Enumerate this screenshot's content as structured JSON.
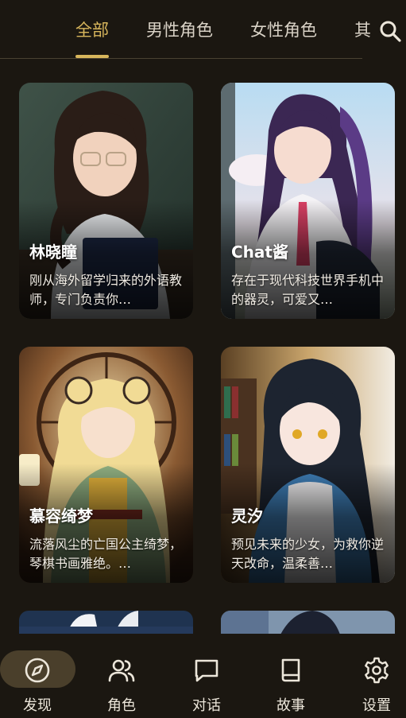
{
  "tabs": [
    {
      "label": "全部",
      "active": true
    },
    {
      "label": "男性角色",
      "active": false
    },
    {
      "label": "女性角色",
      "active": false
    },
    {
      "label": "其",
      "active": false
    }
  ],
  "accent_color": "#d8b65c",
  "search": {
    "icon": "search-icon"
  },
  "cards": [
    {
      "name": "林晓瞳",
      "description": "刚从海外留学归来的外语教师，专门负责你…"
    },
    {
      "name": "Chat酱",
      "description": "存在于现代科技世界手机中的器灵，可爱又…"
    },
    {
      "name": "慕容绮梦",
      "description": "流落风尘的亡国公主绮梦，琴棋书画雅绝。…"
    },
    {
      "name": "灵汐",
      "description": "预见未来的少女，为救你逆天改命，温柔善…"
    }
  ],
  "bottom_nav": [
    {
      "label": "发现",
      "icon": "compass-icon",
      "active": true
    },
    {
      "label": "角色",
      "icon": "users-icon",
      "active": false
    },
    {
      "label": "对话",
      "icon": "chat-bubble-icon",
      "active": false
    },
    {
      "label": "故事",
      "icon": "book-icon",
      "active": false
    },
    {
      "label": "设置",
      "icon": "gear-icon",
      "active": false
    }
  ]
}
